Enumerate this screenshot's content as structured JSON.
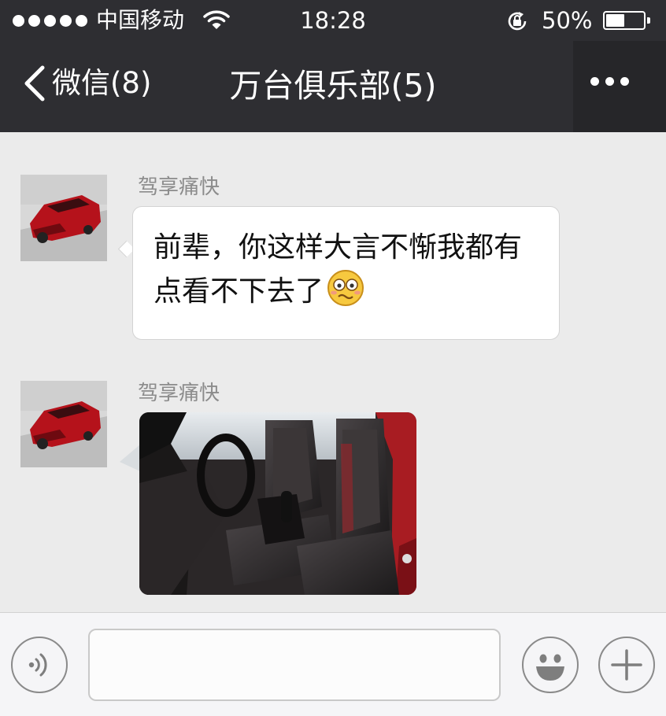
{
  "status_bar": {
    "carrier": "中国移动",
    "time": "18:28",
    "battery_text": "50%",
    "battery_level": 0.5,
    "signal_icon": "signal-dots-icon",
    "wifi_icon": "wifi-icon",
    "lock_icon": "rotation-lock-icon"
  },
  "nav": {
    "back_label": "微信(8)",
    "title": "万台俱乐部(5)",
    "more_icon": "more-dots-icon"
  },
  "messages": [
    {
      "sender": "驾享痛快",
      "line1": "前辈，你这样大言不惭我都有",
      "line2": "点看不下去了",
      "emoji": "awkward-face-emoji"
    },
    {
      "sender": "驾享痛快",
      "image": "car-interior-photo"
    }
  ],
  "input_bar": {
    "voice_icon": "voice-icon",
    "emoji_icon": "emoji-face-icon",
    "add_icon": "plus-icon",
    "text_value": ""
  },
  "colors": {
    "header_bg": "#2e2e32",
    "chat_bg": "#ebebeb",
    "bubble_bg": "#ffffff",
    "input_bar_bg": "#f5f5f7"
  }
}
